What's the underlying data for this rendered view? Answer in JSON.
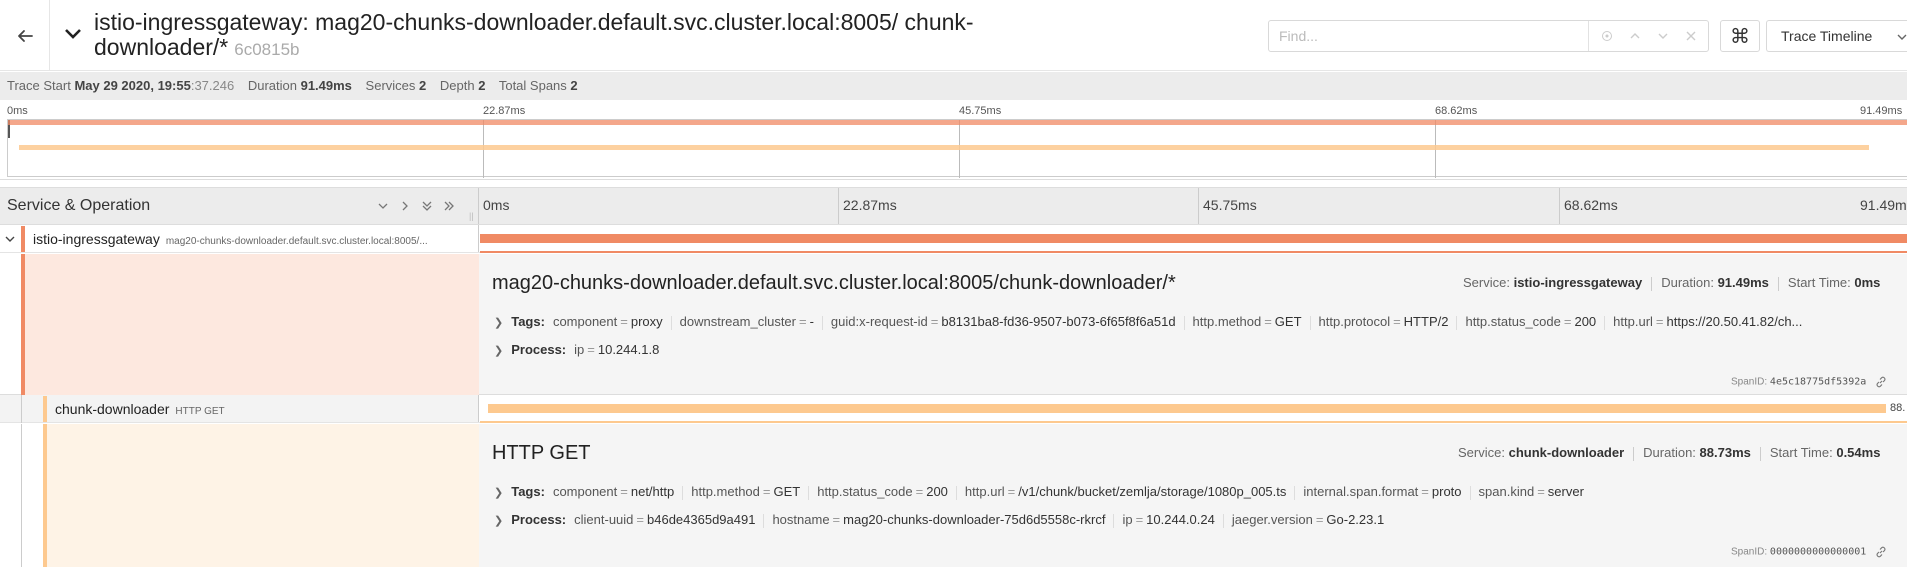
{
  "header": {
    "title_main": "istio-ingressgateway: mag20-chunks-downloader.default.svc.cluster.local:8005/ chunk-downloader/*",
    "trace_id": "6c0815b",
    "find_placeholder": "Find...",
    "keyboard_icon": "⌘",
    "view_selector": "Trace Timeline"
  },
  "info": {
    "trace_start_label": "Trace Start",
    "trace_start_value": "May 29 2020, 19:55",
    "trace_start_seconds": ":37.246",
    "duration_label": "Duration",
    "duration_value": "91.49ms",
    "services_label": "Services",
    "services_value": "2",
    "depth_label": "Depth",
    "depth_value": "2",
    "total_spans_label": "Total Spans",
    "total_spans_value": "2"
  },
  "ticks": [
    "0ms",
    "22.87ms",
    "45.75ms",
    "68.62ms",
    "91.49ms"
  ],
  "columns": {
    "service_operation": "Service & Operation"
  },
  "spans": [
    {
      "service": "istio-ingressgateway",
      "operation": "mag20-chunks-downloader.default.svc.cluster.local:8005/...",
      "color": "#f08a64",
      "start_ms": 0,
      "duration_ms": 91.49,
      "detail_title": "mag20-chunks-downloader.default.svc.cluster.local:8005/chunk-downloader/*",
      "service_label": "Service:",
      "service_value": "istio-ingressgateway",
      "duration_label": "Duration:",
      "duration_value": "91.49ms",
      "start_label": "Start Time:",
      "start_value": "0ms",
      "tags_label": "Tags:",
      "tags": [
        {
          "k": "component",
          "v": "proxy"
        },
        {
          "k": "downstream_cluster",
          "v": "-"
        },
        {
          "k": "guid:x-request-id",
          "v": "b8131ba8-fd36-9507-b073-6f65f8f6a51d"
        },
        {
          "k": "http.method",
          "v": "GET"
        },
        {
          "k": "http.protocol",
          "v": "HTTP/2"
        },
        {
          "k": "http.status_code",
          "v": "200"
        },
        {
          "k": "http.url",
          "v": "https://20.50.41.82/ch..."
        }
      ],
      "process_label": "Process:",
      "process": [
        {
          "k": "ip",
          "v": "10.244.1.8"
        }
      ],
      "spanid_label": "SpanID:",
      "spanid_value": "4e5c18775df5392a"
    },
    {
      "service": "chunk-downloader",
      "operation": "HTTP GET",
      "color": "#fdc98f",
      "start_ms": 0.54,
      "duration_ms": 88.73,
      "bar_label": "88.",
      "detail_title": "HTTP GET",
      "service_label": "Service:",
      "service_value": "chunk-downloader",
      "duration_label": "Duration:",
      "duration_value": "88.73ms",
      "start_label": "Start Time:",
      "start_value": "0.54ms",
      "tags_label": "Tags:",
      "tags": [
        {
          "k": "component",
          "v": "net/http"
        },
        {
          "k": "http.method",
          "v": "GET"
        },
        {
          "k": "http.status_code",
          "v": "200"
        },
        {
          "k": "http.url",
          "v": "/v1/chunk/bucket/zemlja/storage/1080p_005.ts"
        },
        {
          "k": "internal.span.format",
          "v": "proto"
        },
        {
          "k": "span.kind",
          "v": "server"
        }
      ],
      "process_label": "Process:",
      "process": [
        {
          "k": "client-uuid",
          "v": "b46de4365d9a491"
        },
        {
          "k": "hostname",
          "v": "mag20-chunks-downloader-75d6d5558c-rkrcf"
        },
        {
          "k": "ip",
          "v": "10.244.0.24"
        },
        {
          "k": "jaeger.version",
          "v": "Go-2.23.1"
        }
      ],
      "spanid_label": "SpanID:",
      "spanid_value": "0000000000000001"
    }
  ],
  "colors": {
    "span1": "#f08a64",
    "span1_light": "#fde8df",
    "span2": "#fdc98f",
    "span2_light": "#fef3e6"
  }
}
